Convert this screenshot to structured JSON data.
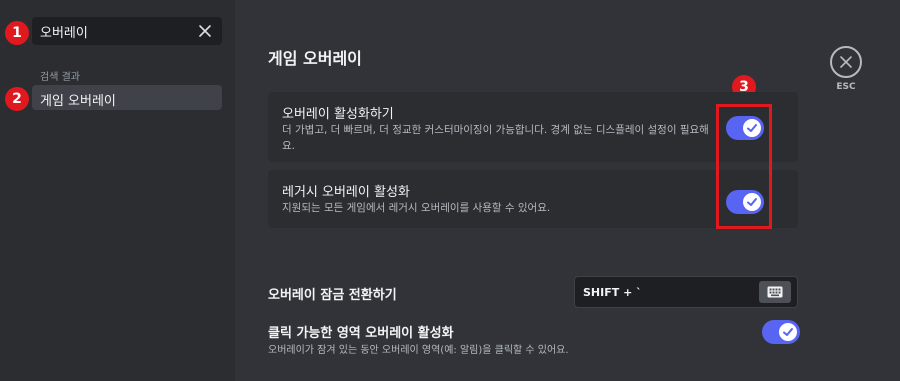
{
  "sidebar": {
    "search": {
      "value": "오버레이",
      "placeholder": ""
    },
    "section_label": "검색 결과",
    "items": [
      {
        "label": "게임 오버레이"
      }
    ]
  },
  "annotations": {
    "badge1": "1",
    "badge2": "2",
    "badge3": "3"
  },
  "main": {
    "title": "게임 오버레이",
    "close_label": "ESC",
    "settings": [
      {
        "title": "오버레이 활성화하기",
        "description": "더 가볍고, 더 빠르며, 더 정교한 커스터마이징이 가능합니다. 경계 없는 디스플레이 설정이 필요해요.",
        "enabled": true
      },
      {
        "title": "레거시 오버레이 활성화",
        "description": "지원되는 모든 게임에서 레거시 오버레이를 사용할 수 있어요.",
        "enabled": true
      }
    ],
    "lock_toggle": {
      "label": "오버레이 잠금 전환하기",
      "keys": "SHIFT + `"
    },
    "clickable_region": {
      "label": "클릭 가능한 영역 오버레이 활성화",
      "description": "오버레이가 잠겨 있는 동안 오버레이 영역(예: 알림)을 클릭할 수 있어요.",
      "enabled": true
    }
  },
  "colors": {
    "accent": "#5865f2",
    "annotation": "#e0191f"
  }
}
